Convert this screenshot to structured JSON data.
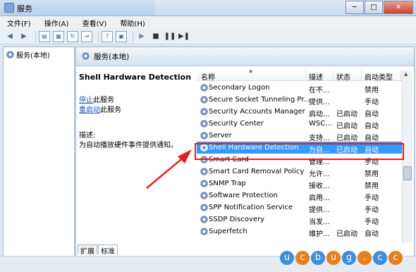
{
  "window": {
    "title": "服务"
  },
  "menu": [
    "文件(F)",
    "操作(A)",
    "查看(V)",
    "帮助(H)"
  ],
  "tree": {
    "root": "服务(本地)"
  },
  "panel": {
    "title": "服务(本地)"
  },
  "detail": {
    "heading": "Shell Hardware Detection",
    "stop_link": "停止",
    "stop_suffix": "此服务",
    "restart_link": "重启动",
    "restart_suffix": "此服务",
    "desc_label": "描述:",
    "desc_text": "为自动播放硬件事件提供通知。"
  },
  "columns": [
    "名称",
    "描述",
    "状态",
    "启动类型"
  ],
  "rows": [
    {
      "name": "Secondary Logon",
      "desc": "在不...",
      "status": "",
      "start": "禁用"
    },
    {
      "name": "Secure Socket Tunneling Pr...",
      "desc": "提供...",
      "status": "",
      "start": "手动"
    },
    {
      "name": "Security Accounts Manager",
      "desc": "启动...",
      "status": "已启动",
      "start": "自动"
    },
    {
      "name": "Security Center",
      "desc": "WSC...",
      "status": "已启动",
      "start": "自动"
    },
    {
      "name": "Server",
      "desc": "支持...",
      "status": "已启动",
      "start": "自动"
    },
    {
      "name": "Shell Hardware Detection",
      "desc": "为自...",
      "status": "已启动",
      "start": "自动"
    },
    {
      "name": "Smart Card",
      "desc": "管理...",
      "status": "",
      "start": "手动"
    },
    {
      "name": "Smart Card Removal Policy",
      "desc": "允许...",
      "status": "",
      "start": "禁用"
    },
    {
      "name": "SNMP Trap",
      "desc": "接收...",
      "status": "",
      "start": "禁用"
    },
    {
      "name": "Software Protection",
      "desc": "启用...",
      "status": "",
      "start": "手动"
    },
    {
      "name": "SPP Notification Service",
      "desc": "提供...",
      "status": "",
      "start": "手动"
    },
    {
      "name": "SSDP Discovery",
      "desc": "当发...",
      "status": "",
      "start": "手动"
    },
    {
      "name": "Superfetch",
      "desc": "维护...",
      "status": "已启动",
      "start": "自动"
    }
  ],
  "tabs": [
    "扩展",
    "标准"
  ],
  "watermark": [
    "u",
    "c",
    "b",
    "u",
    "g",
    ".",
    "c",
    "c"
  ],
  "colors": {
    "selection": "#3399ff",
    "highlight_box": "#e02020",
    "arrow": "#e02020"
  }
}
